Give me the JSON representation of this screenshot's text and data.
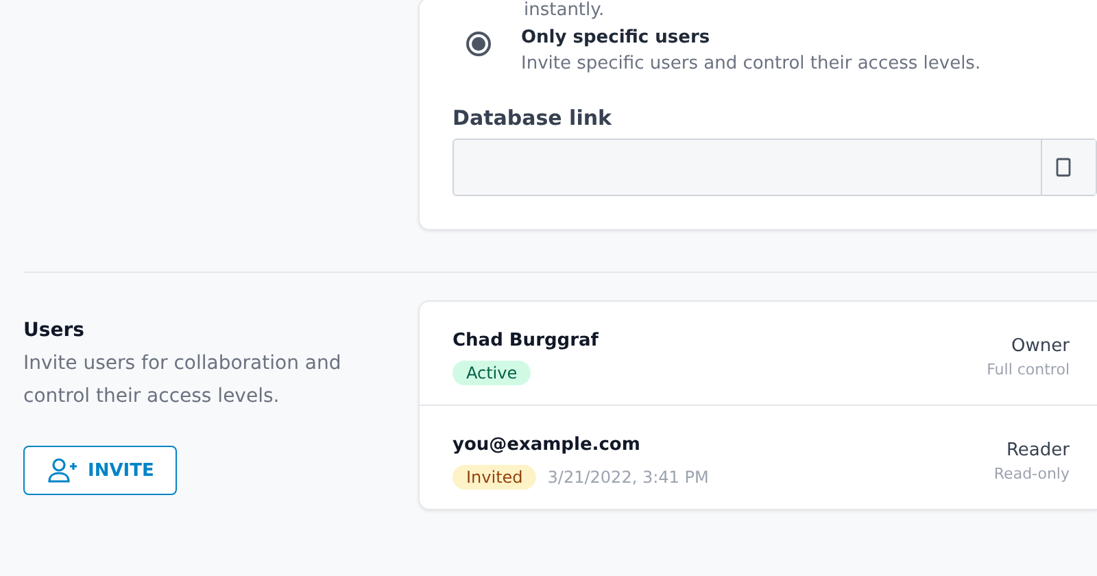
{
  "sharing_card": {
    "cut_text": "instantly.",
    "options": [
      {
        "label": "Only specific users",
        "description": "Invite specific users and control their access levels.",
        "selected": true
      }
    ],
    "database_link": {
      "label": "Database link"
    }
  },
  "users_section": {
    "title": "Users",
    "description": "Invite users for collaboration and control their access levels.",
    "invite_button": "INVITE"
  },
  "users": [
    {
      "name": "Chad Burggraf",
      "status": {
        "kind": "active",
        "label": "Active"
      },
      "role": "Owner",
      "role_description": "Full control"
    },
    {
      "name": "you@example.com",
      "status": {
        "kind": "invited",
        "label": "Invited"
      },
      "date": "3/21/2022, 3:41 PM",
      "role": "Reader",
      "role_description": "Read-only"
    }
  ]
}
